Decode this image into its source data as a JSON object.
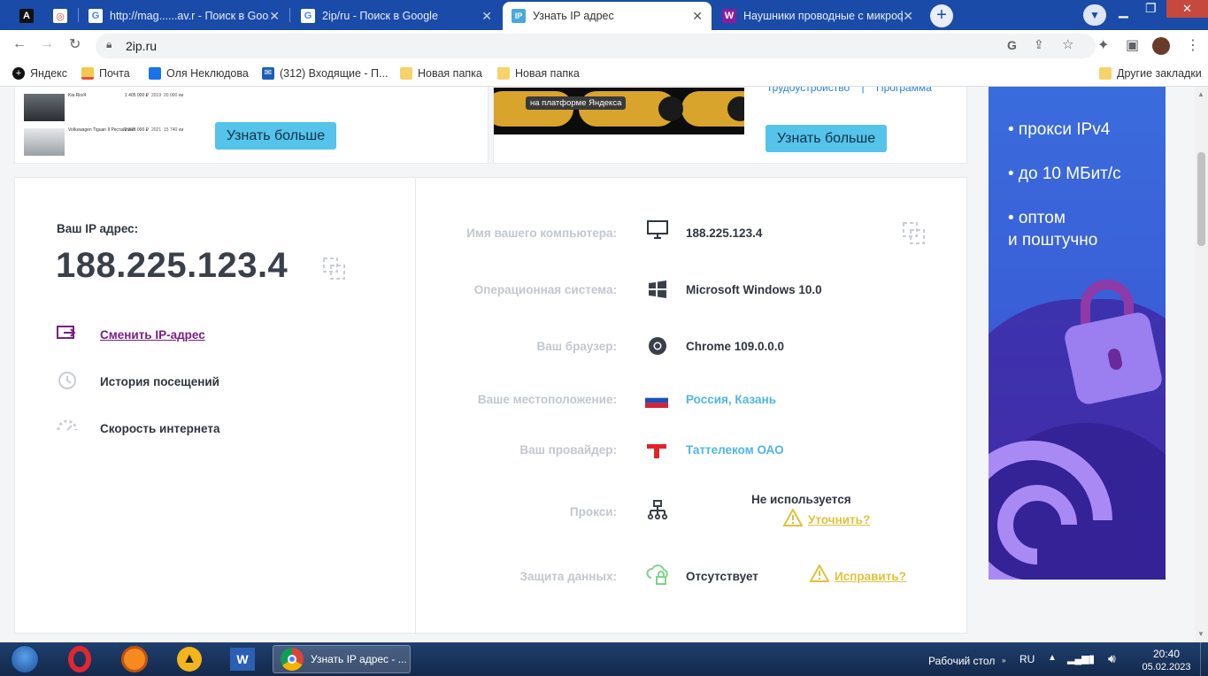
{
  "browser": {
    "tabs": [
      {
        "title": "",
        "favicon": "A",
        "fav_bg": "#111111",
        "fav_fg": "#ffffff"
      },
      {
        "title": "",
        "favicon": "◎",
        "fav_bg": "#ffffff",
        "fav_fg": "#d6453d"
      },
      {
        "title": "http://mag......av.r - Поиск в Goo",
        "favicon": "G",
        "fav_bg": "#ffffff",
        "fav_fg": "#4285f4"
      },
      {
        "title": "2ip/ru - Поиск в Google",
        "favicon": "G",
        "fav_bg": "#ffffff",
        "fav_fg": "#4285f4"
      },
      {
        "title": "Узнать IP адрес",
        "favicon": "IP",
        "fav_bg": "#4aa8df",
        "fav_fg": "#ffffff"
      },
      {
        "title": "Наушники проводные с микроф",
        "favicon": "W",
        "fav_bg": "#8a1f9c",
        "fav_fg": "#ffffff"
      }
    ],
    "new_tab": "+",
    "url": "2ip.ru",
    "bookmarks": [
      {
        "label": "Яндекс",
        "icon": "yandex-icon"
      },
      {
        "label": "Почта",
        "icon": "mail-icon"
      },
      {
        "label": "Оля Неклюдова",
        "icon": "chat-icon"
      },
      {
        "label": "(312) Входящие - П...",
        "icon": "inbox-icon"
      },
      {
        "label": "Новая папка",
        "icon": "folder-icon"
      },
      {
        "label": "Новая папка",
        "icon": "folder-icon"
      }
    ],
    "other_bookmarks": "Другие закладки"
  },
  "ads": {
    "left_button": "Узнать больше",
    "right_button": "Узнать больше",
    "right_caption": "на платформе Яндекса",
    "right_links": [
      "Трудоустройство",
      "|",
      "Программа"
    ],
    "car_rows": [
      {
        "name": "Kia Rio/4",
        "price": "1 405 000 ₽",
        "year": "2019",
        "mileage": "20 000 км"
      },
      {
        "name": "Volkswagen Tiguan II Рестайлинг",
        "price": "2 378 000 ₽",
        "year": "2021",
        "mileage": "15 740 км"
      }
    ]
  },
  "ip_panel": {
    "label": "Ваш IP адрес:",
    "ip": "188.225.123.4",
    "actions": [
      {
        "label": "Сменить IP-адрес",
        "icon": "change-ip-icon",
        "color": "#7a1f86"
      },
      {
        "label": "История посещений",
        "icon": "history-icon",
        "color": "#2f3640"
      },
      {
        "label": "Скорость интернета",
        "icon": "speed-icon",
        "color": "#2f3640"
      }
    ]
  },
  "details": [
    {
      "label": "Имя вашего компьютера:",
      "value": "188.225.123.4",
      "icon": "monitor-icon"
    },
    {
      "label": "Операционная система:",
      "value": "Microsoft Windows 10.0",
      "icon": "windows-icon"
    },
    {
      "label": "Ваш браузер:",
      "value": "Chrome 109.0.0.0",
      "icon": "chrome-icon"
    },
    {
      "label": "Ваше местоположение:",
      "value": "Россия, Казань",
      "icon": "russia-flag-icon"
    },
    {
      "label": "Ваш провайдер:",
      "value": "Таттелеком ОАО",
      "icon": "provider-icon"
    },
    {
      "label": "Прокси:",
      "value": "Не используется",
      "icon": "network-icon",
      "link": "Уточнить?"
    },
    {
      "label": "Защита данных:",
      "value": "Отсутствует",
      "icon": "cloud-lock-icon",
      "link": "Исправить?"
    }
  ],
  "banner": {
    "lines": [
      "• прокси IPv4",
      "• до 10 МБит/с",
      "• оптом",
      "и поштучно"
    ]
  },
  "taskbar": {
    "window_title": "Узнать IP адрес - ...",
    "desktop": "Рабочий стол",
    "lang": "RU",
    "time": "20:40",
    "date": "05.02.2023"
  }
}
